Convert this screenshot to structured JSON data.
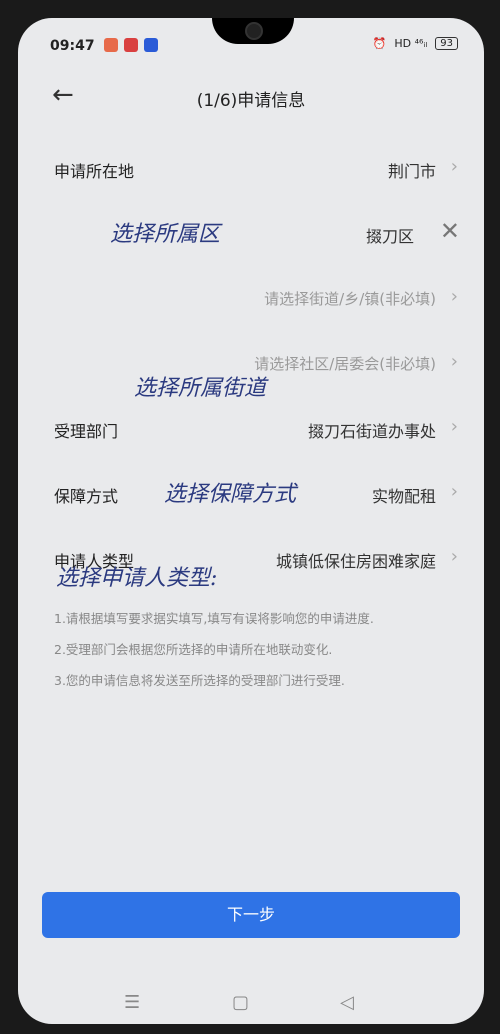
{
  "status_bar": {
    "time": "09:47",
    "network": "HD ⁴⁶ᵢₗ",
    "battery": "93"
  },
  "header": {
    "title": "(1/6)申请信息",
    "back_icon": "arrow-left"
  },
  "form": {
    "location": {
      "label": "申请所在地",
      "value": "荆门市"
    },
    "district": {
      "value": "掇刀区"
    },
    "street": {
      "placeholder": "请选择街道/乡/镇(非必填)"
    },
    "community": {
      "placeholder": "请选择社区/居委会(非必填)"
    },
    "department": {
      "label": "受理部门",
      "value": "掇刀石街道办事处"
    },
    "guarantee": {
      "label": "保障方式",
      "value": "实物配租"
    },
    "applicant_type": {
      "label": "申请人类型",
      "value": "城镇低保住房困难家庭"
    }
  },
  "annotations": {
    "district": "选择所属区",
    "street": "选择所属街道",
    "guarantee": "选择保障方式",
    "applicant": "选择申请人类型:"
  },
  "tips": [
    "1.请根据填写要求据实填写,填写有误将影响您的申请进度.",
    "2.受理部门会根据您所选择的申请所在地联动变化.",
    "3.您的申请信息将发送至所选择的受理部门进行受理."
  ],
  "next_button": {
    "label": "下一步"
  },
  "nav_bar": {
    "menu": "☰",
    "home": "▢",
    "back": "◁"
  }
}
